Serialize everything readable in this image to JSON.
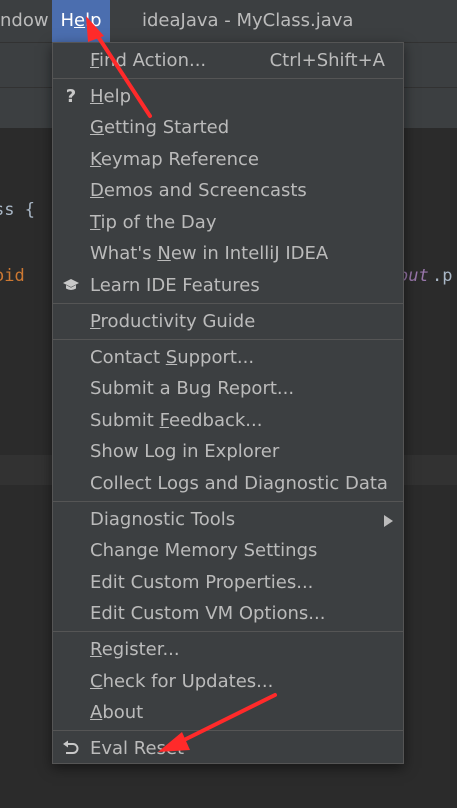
{
  "menubar": {
    "window_label": "ndow",
    "help_label_pre": "H",
    "help_label_ul": "e",
    "help_label_post": "lp",
    "title": "ideaJava - MyClass.java"
  },
  "editor": {
    "class_brace": "ss {",
    "void_kw": "oid",
    "out_field": "out",
    "dot_p": ".p"
  },
  "menu": {
    "find_action": {
      "ul": "F",
      "rest": "ind Action...",
      "shortcut": "Ctrl+Shift+A"
    },
    "help": {
      "ul": "H",
      "rest": "elp",
      "icon": "question-mark"
    },
    "getting_started": {
      "ul": "G",
      "rest": "etting Started"
    },
    "keymap_reference": {
      "ul": "K",
      "rest": "eymap Reference"
    },
    "demos": {
      "ul": "D",
      "rest": "emos and Screencasts"
    },
    "tip_of_day": {
      "ul": "T",
      "rest": "ip of the Day"
    },
    "whats_new": {
      "pre": "What's ",
      "ul": "N",
      "rest": "ew in IntelliJ IDEA"
    },
    "learn_ide": {
      "label": "Learn IDE Features",
      "icon": "graduation-cap"
    },
    "productivity": {
      "ul": "P",
      "rest": "roductivity Guide"
    },
    "contact_support": {
      "pre": "Contact ",
      "ul": "S",
      "rest": "upport..."
    },
    "submit_bug": {
      "label": "Submit a Bug Report..."
    },
    "submit_feedback": {
      "pre": "Submit ",
      "ul": "F",
      "rest": "eedback..."
    },
    "show_log": {
      "label": "Show Log in Explorer"
    },
    "collect_logs": {
      "label": "Collect Logs and Diagnostic Data"
    },
    "diagnostic_tools": {
      "label": "Diagnostic Tools"
    },
    "change_memory": {
      "label": "Change Memory Settings"
    },
    "edit_custom_props": {
      "label": "Edit Custom Properties..."
    },
    "edit_custom_vm": {
      "label": "Edit Custom VM Options..."
    },
    "register": {
      "ul": "R",
      "rest": "egister..."
    },
    "check_updates": {
      "ul": "C",
      "rest": "heck for Updates..."
    },
    "about": {
      "ul": "A",
      "rest": "bout"
    },
    "eval_reset": {
      "label": "Eval Reset",
      "icon": "undo-arrow"
    }
  },
  "colors": {
    "menu_bg": "#3c3f41",
    "menu_highlight": "#4b6eaf",
    "editor_bg": "#2b2b2b",
    "annotation_arrow": "#ff2a2a"
  }
}
